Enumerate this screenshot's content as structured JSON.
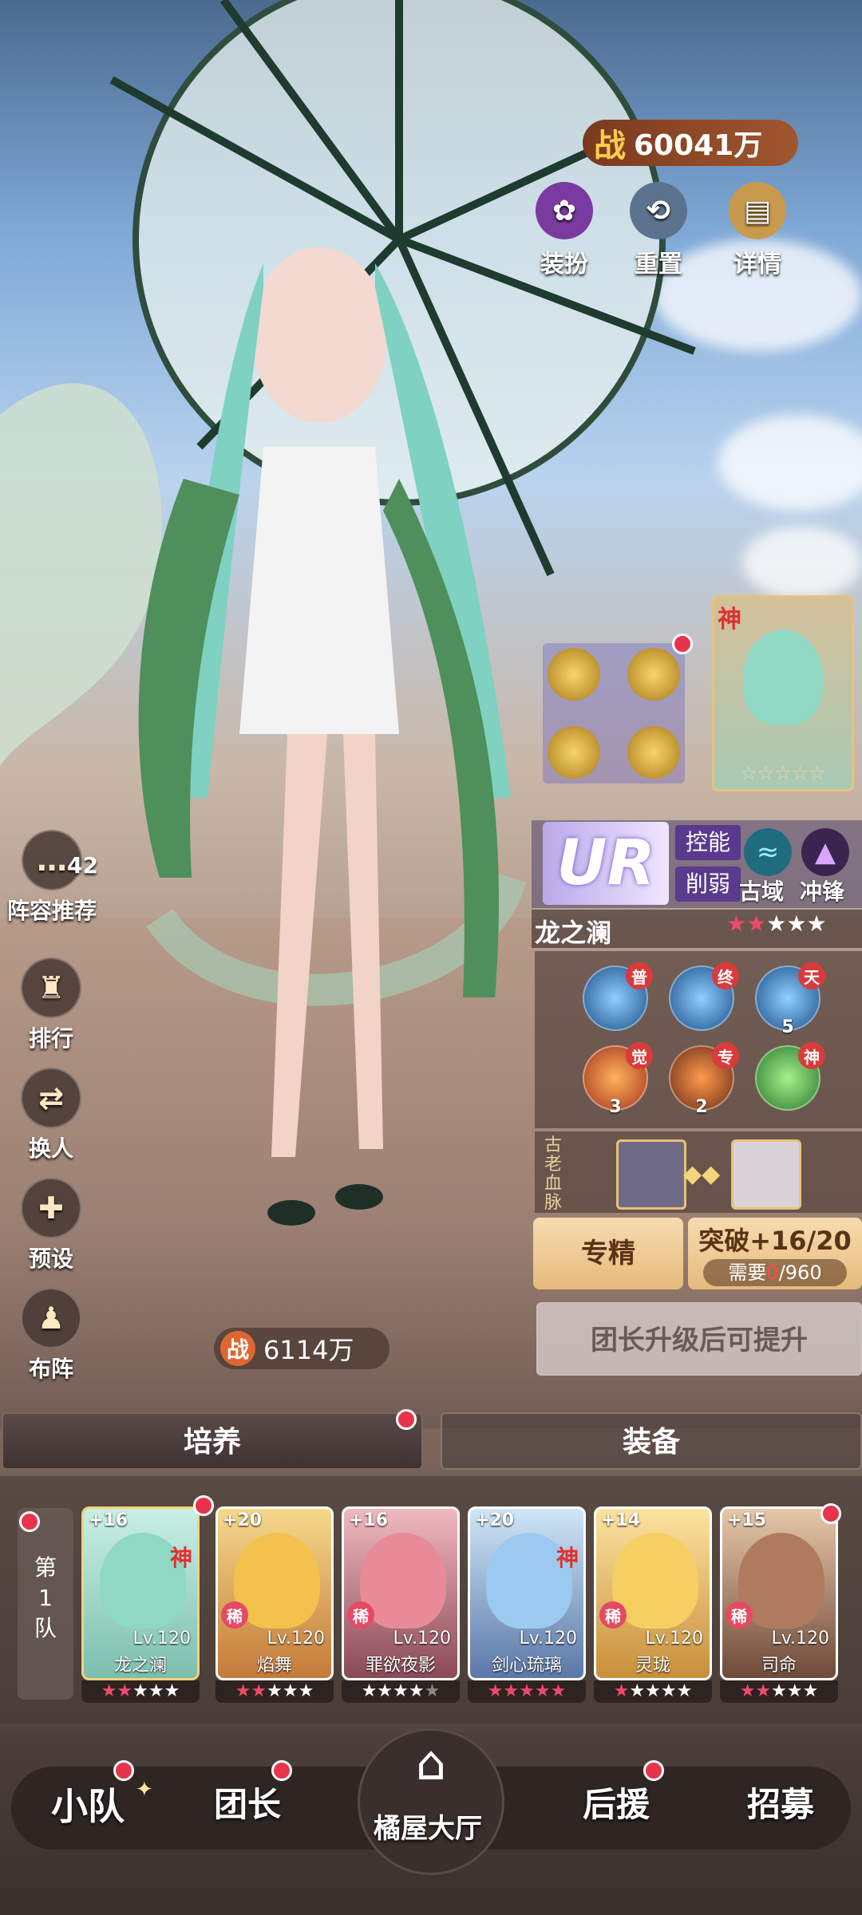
{
  "power": {
    "icon": "战",
    "value": "60041万"
  },
  "top_actions": [
    {
      "label": "装扮",
      "icon": "dress-icon",
      "color": "#7b3aa0"
    },
    {
      "label": "重置",
      "icon": "reset-icon",
      "color": "#5c7390"
    },
    {
      "label": "详情",
      "icon": "book-icon",
      "color": "#c79a4e"
    }
  ],
  "side_menu": [
    {
      "label": "阵容推荐",
      "badge": "42",
      "icon": "chat-icon"
    },
    {
      "label": "排行",
      "icon": "trophy-icon"
    },
    {
      "label": "换人",
      "icon": "swap-icon"
    },
    {
      "label": "预设",
      "icon": "gamepad-icon"
    },
    {
      "label": "布阵",
      "icon": "formation-icon"
    }
  ],
  "character": {
    "tag": "神",
    "rarity": "UR",
    "traits": [
      "控能",
      "削弱"
    ],
    "factions": [
      "古域",
      "冲锋"
    ],
    "name": "龙之澜",
    "stars_filled": 2,
    "stars_total": 5,
    "power_icon": "战",
    "power": "6114万",
    "skills": [
      {
        "tag": "普",
        "num": ""
      },
      {
        "tag": "终",
        "num": ""
      },
      {
        "tag": "天",
        "num": "5"
      },
      {
        "tag": "觉",
        "num": "3"
      },
      {
        "tag": "专",
        "num": "2"
      },
      {
        "tag": "神",
        "num": ""
      }
    ],
    "bloodline_label": "古老血脉",
    "specialize_label": "专精",
    "breakthrough_label": "突破+16/20",
    "need_label": "需要",
    "need_have": "0",
    "need_total": "/960",
    "locked_hint": "团长升级后可提升"
  },
  "tabs": {
    "cultivate": "培养",
    "equipment": "装备"
  },
  "team": {
    "label_line1": "第",
    "label_line2": "1",
    "label_line3": "队",
    "members": [
      {
        "plus": "+16",
        "lv": "Lv.120",
        "name": "龙之澜",
        "tag": "神",
        "stars": "★★★★★",
        "color": "#8fd8c4"
      },
      {
        "plus": "+20",
        "lv": "Lv.120",
        "name": "焰舞",
        "tag": "稀",
        "stars": "★★★★★",
        "color": "#f2c14e"
      },
      {
        "plus": "+16",
        "lv": "Lv.120",
        "name": "罪欲夜影",
        "tag": "稀",
        "stars": "★★★★★",
        "color": "#e98a98"
      },
      {
        "plus": "+20",
        "lv": "Lv.120",
        "name": "剑心琉璃",
        "tag": "神",
        "stars": "★★★★★",
        "color": "#9cc9ef"
      },
      {
        "plus": "+14",
        "lv": "Lv.120",
        "name": "灵珑",
        "tag": "稀",
        "stars": "★★★★★",
        "color": "#f5cf62"
      },
      {
        "plus": "+15",
        "lv": "Lv.120",
        "name": "司命",
        "tag": "稀",
        "stars": "★★★★★",
        "color": "#b07a5e"
      }
    ]
  },
  "nav": {
    "squad": "小队",
    "captain": "团长",
    "hall": "橘屋大厅",
    "support": "后援",
    "recruit": "招募"
  }
}
